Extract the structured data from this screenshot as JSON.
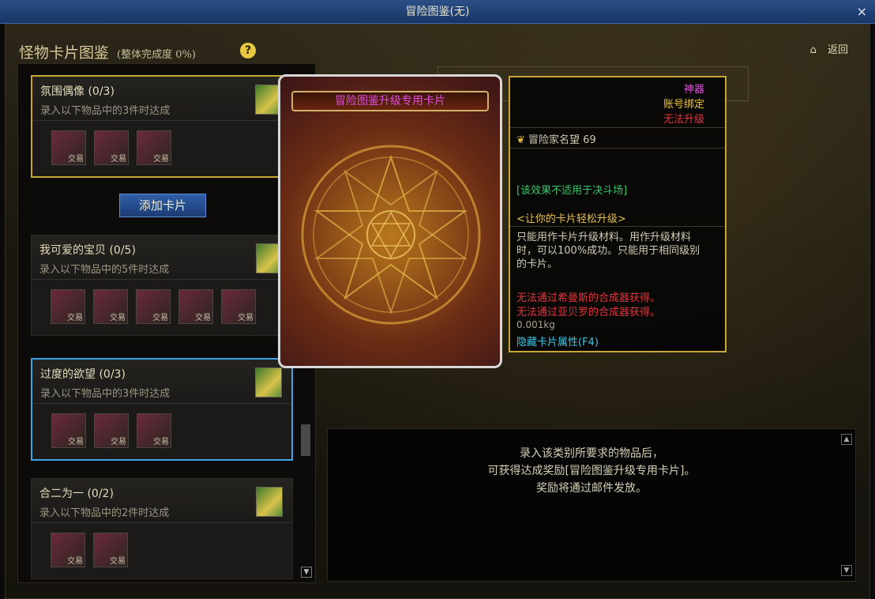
{
  "window": {
    "title": "冒险图鉴(无)"
  },
  "header": {
    "title": "怪物卡片图鉴",
    "subtitle": "(整体完成度 0%)",
    "help_glyph": "?",
    "home_glyph": "⌂",
    "back_label": "返回"
  },
  "add_card_label": "添加卡片",
  "cards": [
    {
      "name": "氛围偶像 (0/3)",
      "desc": "录入以下物品中的3件时达成",
      "slot_tag": "交易"
    },
    {
      "name": "我可爱的宝贝 (0/5)",
      "desc": "录入以下物品中的5件时达成",
      "slot_tag": "交易"
    },
    {
      "name": "过度的欲望 (0/3)",
      "desc": "录入以下物品中的3件时达成",
      "slot_tag": "交易"
    },
    {
      "name": "合二为一 (0/2)",
      "desc": "录入以下物品中的2件时达成",
      "slot_tag": "交易"
    }
  ],
  "popup": {
    "banner": "冒险图鉴升级专用卡片"
  },
  "tooltip": {
    "rarity": "神器",
    "bind": "账号绑定",
    "upgrade": "无法升级",
    "fame_label": "冒险家名望",
    "fame_value": "69",
    "note_green": "[该效果不适用于决斗场]",
    "note_gold": "<让你的卡片轻松升级>",
    "body": "只能用作卡片升级材料。用作升级材料时，可以100%成功。只能用于相同级别的卡片。",
    "red1": "无法通过希曼斯的合成器获得。",
    "red2": "无法通过亚贝罗的合成器获得。",
    "weight": "0.001kg",
    "hidden": "隐藏卡片属性(F4)"
  },
  "info": {
    "line1": "录入该类别所要求的物品后，",
    "line2": "可获得达成奖励[冒险图鉴升级专用卡片]。",
    "line3": "奖励将通过邮件发放。"
  },
  "close_glyph": "×",
  "scroll_up_glyph": "▲",
  "scroll_down_glyph": "▼"
}
